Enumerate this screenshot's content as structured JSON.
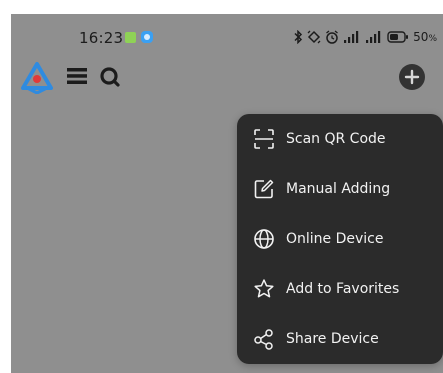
{
  "status_bar": {
    "time": "16:23",
    "battery_percent": "50",
    "battery_unit": "%"
  },
  "toolbar": {
    "icons": [
      "app-logo",
      "menu-icon",
      "search-icon",
      "add-icon"
    ]
  },
  "dropdown_menu": {
    "items": [
      {
        "label": "Scan QR Code",
        "icon": "scan-qr-icon"
      },
      {
        "label": "Manual Adding",
        "icon": "edit-icon"
      },
      {
        "label": "Online Device",
        "icon": "globe-icon"
      },
      {
        "label": "Add to Favorites",
        "icon": "star-icon"
      },
      {
        "label": "Share Device",
        "icon": "share-icon"
      }
    ]
  },
  "colors": {
    "overlay_background": "#8f8f8f",
    "menu_background": "#2b2b2b",
    "menu_text": "#f2f2f2",
    "logo_blue": "#2f8be0",
    "logo_red": "#e03a3a"
  }
}
